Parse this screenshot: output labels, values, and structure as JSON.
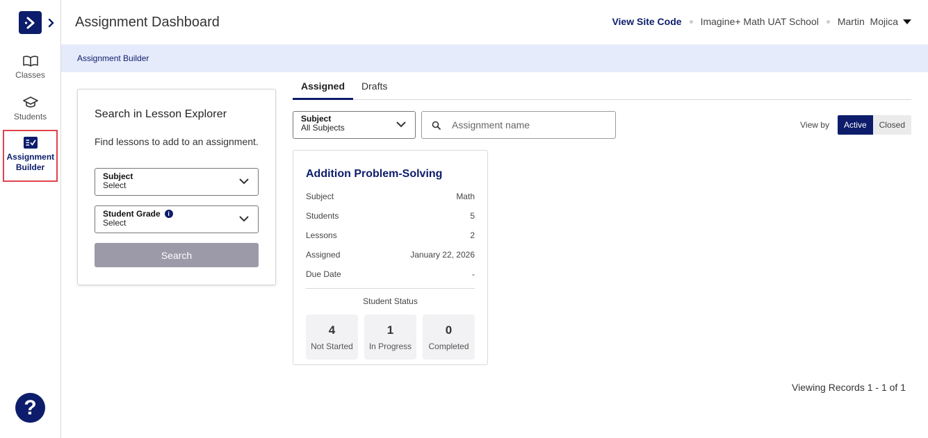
{
  "header": {
    "title": "Assignment Dashboard",
    "site_code": "View Site Code",
    "school": "Imagine+ Math UAT School",
    "user": "Martin  Mojica"
  },
  "sidebar": {
    "items": [
      {
        "label": "Classes",
        "icon": "book-open-icon"
      },
      {
        "label": "Students",
        "icon": "graduation-cap-icon"
      },
      {
        "label": "Assignment Builder",
        "icon": "checklist-icon",
        "active": true
      }
    ],
    "help": "?"
  },
  "breadcrumb": {
    "current": "Assignment Builder"
  },
  "lesson_explorer": {
    "title": "Search in Lesson Explorer",
    "description": "Find lessons to add to an assignment.",
    "subject": {
      "label": "Subject",
      "value": "Select"
    },
    "grade": {
      "label": "Student Grade",
      "value": "Select"
    },
    "search_button": "Search"
  },
  "tabs": [
    {
      "label": "Assigned",
      "active": true
    },
    {
      "label": "Drafts",
      "active": false
    }
  ],
  "filters": {
    "subject": {
      "label": "Subject",
      "value": "All Subjects"
    },
    "search_placeholder": "Assignment name",
    "view_by_label": "View by",
    "view_by_options": [
      "Active",
      "Closed"
    ],
    "view_by_selected": "Active"
  },
  "assignment": {
    "title": "Addition Problem-Solving",
    "rows": [
      {
        "label": "Subject",
        "value": "Math"
      },
      {
        "label": "Students",
        "value": "5"
      },
      {
        "label": "Lessons",
        "value": "2"
      },
      {
        "label": "Assigned",
        "value": "January 22, 2026"
      },
      {
        "label": "Due Date",
        "value": "-"
      }
    ],
    "status_title": "Student Status",
    "status": [
      {
        "count": "4",
        "label": "Not Started"
      },
      {
        "count": "1",
        "label": "In Progress"
      },
      {
        "count": "0",
        "label": "Completed"
      }
    ]
  },
  "pagination": {
    "text": "Viewing Records 1 - 1 of 1"
  },
  "colors": {
    "brand": "#0d1d6b",
    "active_outline": "#e0434b",
    "breadcrumb_bg": "#e6ebfb"
  }
}
